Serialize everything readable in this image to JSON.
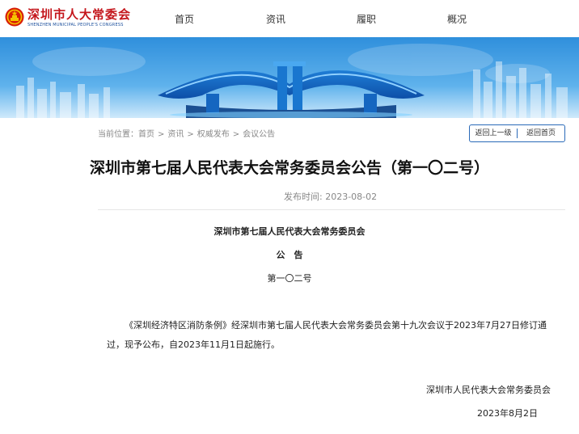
{
  "header": {
    "logo_cn": "深圳市人大常委会",
    "logo_en": "SHENZHEN MUNICIPAL PEOPLE'S CONGRESS",
    "nav": [
      "首页",
      "资讯",
      "履职",
      "概况"
    ]
  },
  "breadcrumb": {
    "prefix": "当前位置：",
    "items": [
      "首页",
      "资讯",
      "权威发布",
      "会议公告"
    ],
    "separator": ">"
  },
  "buttons": {
    "up_level": "返回上一级",
    "home": "返回首页"
  },
  "article": {
    "title": "深圳市第七届人民代表大会常务委员会公告（第一〇二号）",
    "publish_time": "发布时间: 2023-08-02",
    "org_heading": "深圳市第七届人民代表大会常务委员会",
    "notice_heading": "公　告",
    "number": "第一〇二号",
    "paragraph": "《深圳经济特区消防条例》经深圳市第七届人民代表大会常务委员会第十九次会议于2023年7月27日修订通过，现予公布，自2023年11月1日起施行。",
    "signature": "深圳市人民代表大会常务委员会",
    "date": "2023年8月2日"
  },
  "colors": {
    "brand_red": "#c4161c",
    "brand_blue": "#1b4f9c",
    "banner_sky": "#3a9ae0",
    "button_border": "#2a6ab8"
  },
  "icons": {
    "logo": "national-emblem-icon"
  }
}
